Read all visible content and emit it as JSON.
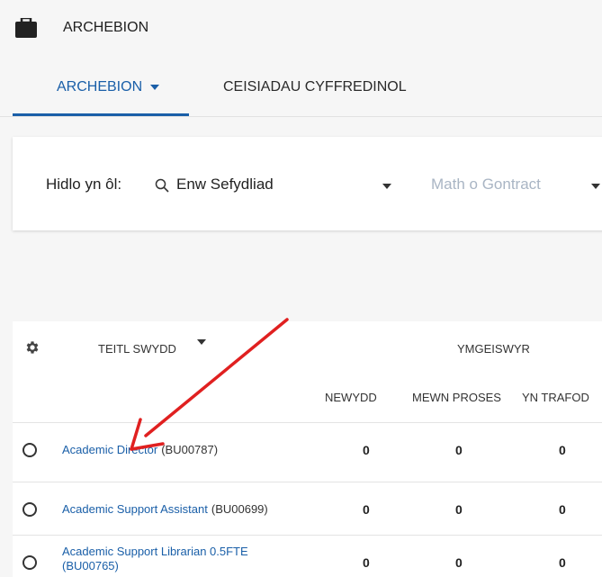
{
  "header": {
    "title": "ARCHEBION",
    "icon": "briefcase-icon"
  },
  "tabs": [
    {
      "label": "ARCHEBION",
      "active": true
    },
    {
      "label": "CEISIADAU CYFFREDINOL",
      "active": false
    }
  ],
  "filter": {
    "label": "Hidlo yn ôl:",
    "org_value": "Enw Sefydliad",
    "contract_placeholder": "Math o Gontract"
  },
  "table": {
    "title_header": "TEITL SWYDD",
    "applicants_header": "YMGEISWYR",
    "sub_headers": {
      "new": "NEWYDD",
      "in_process": "MEWN PROSES",
      "discussing": "YN TRAFOD"
    },
    "rows": [
      {
        "title": "Academic Director",
        "code": "(BU00787)",
        "new": "0",
        "in_process": "0",
        "discussing": "0"
      },
      {
        "title": "Academic Support Assistant",
        "code": "(BU00699)",
        "new": "0",
        "in_process": "0",
        "discussing": "0"
      },
      {
        "title": "Academic Support Librarian 0.5FTE",
        "code": "(BU00765)",
        "new": "0",
        "in_process": "0",
        "discussing": "0"
      }
    ]
  },
  "colors": {
    "accent": "#1a5fa8",
    "annotation_arrow": "#e02020"
  }
}
